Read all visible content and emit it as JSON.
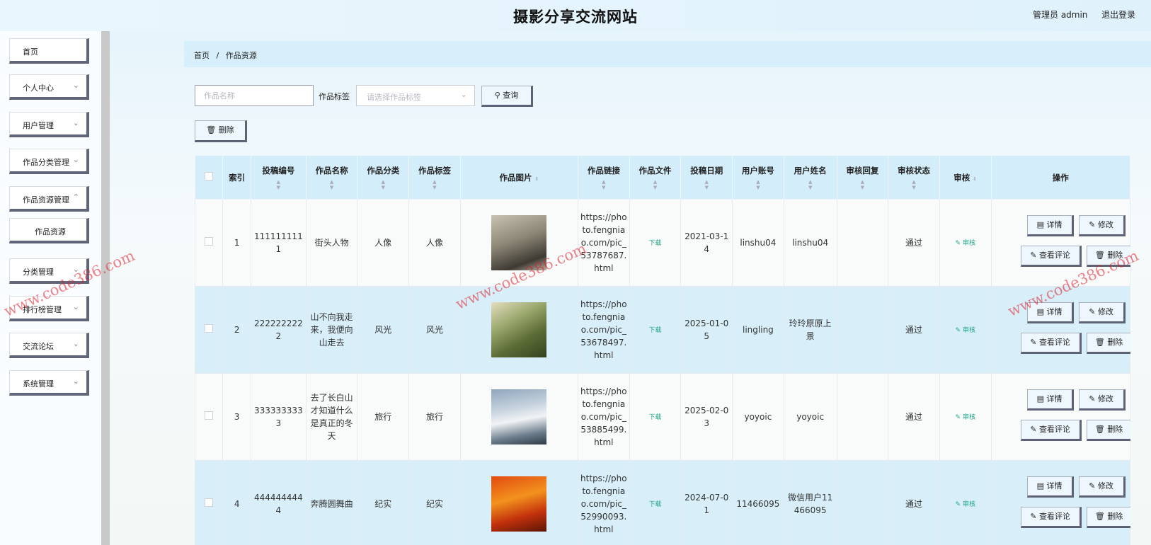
{
  "header": {
    "title": "摄影分享交流网站",
    "user": "管理员 admin",
    "logout": "退出登录"
  },
  "sidebar": {
    "items": [
      {
        "label": "首页"
      },
      {
        "label": "个人中心"
      },
      {
        "label": "用户管理"
      },
      {
        "label": "作品分类管理"
      },
      {
        "label": "作品资源管理"
      },
      {
        "label": "作品资源"
      },
      {
        "label": "分类管理"
      },
      {
        "label": "排行榜管理"
      },
      {
        "label": "交流论坛"
      },
      {
        "label": "系统管理"
      }
    ]
  },
  "breadcrumb": {
    "home": "首页",
    "sep": "/",
    "current": "作品资源"
  },
  "search": {
    "name_placeholder": "作品名称",
    "tag_label": "作品标签",
    "tag_placeholder": "请选择作品标签",
    "query_label": "查询",
    "delete_label": "删除"
  },
  "table": {
    "headers": [
      "索引",
      "投稿编号",
      "作品名称",
      "作品分类",
      "作品标签",
      "作品图片",
      "作品链接",
      "作品文件",
      "投稿日期",
      "用户账号",
      "用户姓名",
      "审核回复",
      "审核状态",
      "审核",
      "操作"
    ],
    "rows": [
      {
        "index": "1",
        "code": "1111111111",
        "name": "街头人物",
        "category": "人像",
        "tag": "人像",
        "link": "https://photo.fengniao.com/pic_53787687.html",
        "file": "下载",
        "date": "2021-03-14",
        "account": "linshu04",
        "username": "linshu04",
        "reply": "",
        "status": "通过",
        "audit": "审核"
      },
      {
        "index": "2",
        "code": "2222222222",
        "name": "山不向我走来，我便向山走去",
        "category": "风光",
        "tag": "风光",
        "link": "https://photo.fengniao.com/pic_53678497.html",
        "file": "下载",
        "date": "2025-01-05",
        "account": "lingling",
        "username": "玲玲原原上景",
        "reply": "",
        "status": "通过",
        "audit": "审核"
      },
      {
        "index": "3",
        "code": "3333333333",
        "name": "去了长白山才知道什么是真正的冬天",
        "category": "旅行",
        "tag": "旅行",
        "link": "https://photo.fengniao.com/pic_53885499.html",
        "file": "下载",
        "date": "2025-02-03",
        "account": "yoyoic",
        "username": "yoyoic",
        "reply": "",
        "status": "通过",
        "audit": "审核"
      },
      {
        "index": "4",
        "code": "4444444444",
        "name": "奔腾圆舞曲",
        "category": "纪实",
        "tag": "纪实",
        "link": "https://photo.fengniao.com/pic_52990093.html",
        "file": "下载",
        "date": "2024-07-01",
        "account": "11466095",
        "username": "微信用户11466095",
        "reply": "",
        "status": "通过",
        "audit": "审核"
      }
    ],
    "ops": {
      "detail": "详情",
      "edit": "修改",
      "comment": "查看评论",
      "delete": "删除"
    }
  },
  "watermark": "www.code386.com"
}
